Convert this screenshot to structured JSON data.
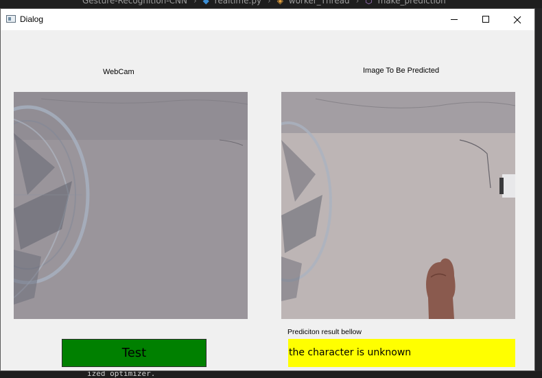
{
  "ide": {
    "breadcrumb": [
      "Gesture-Recognition-CNN",
      "realtime.py",
      "worker_Thread",
      "make_prediction"
    ],
    "code_fragment": "ized optimizer."
  },
  "window": {
    "title": "Dialog",
    "minimize_icon": "minimize-icon",
    "maximize_icon": "maximize-icon",
    "close_icon": "close-icon"
  },
  "labels": {
    "webcam": "WebCam",
    "image_to_predict": "Image To Be Predicted",
    "result_caption": "Prediciton result bellow"
  },
  "buttons": {
    "test": "Test"
  },
  "result": {
    "text": "the character is unknown",
    "background": "#ffff00"
  },
  "colors": {
    "test_button": "#008000",
    "result_box": "#ffff00"
  }
}
